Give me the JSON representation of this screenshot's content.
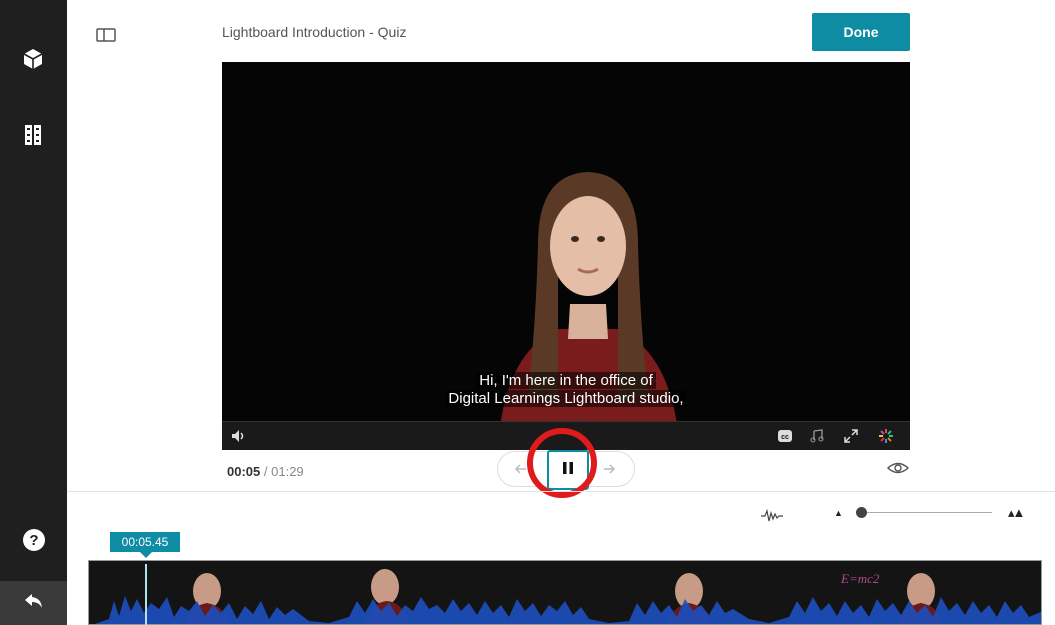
{
  "header": {
    "title": "Lightboard Introduction - Quiz",
    "done_label": "Done"
  },
  "video": {
    "caption_line1": "Hi, I'm here in the office of",
    "caption_line2": "Digital Learnings Lightboard studio,"
  },
  "player": {
    "current_time": "00:05",
    "separator": "/",
    "total_time": "01:29"
  },
  "timeline": {
    "marker_time": "00:05.45",
    "formula_text": "E=mc2"
  },
  "icons": {
    "sidebar": [
      "cube-icon",
      "film-icon",
      "help-icon",
      "back-icon"
    ],
    "video_bar": [
      "volume-icon",
      "closed-captions-icon",
      "music-icon",
      "fullscreen-icon",
      "brand-icon"
    ]
  },
  "colors": {
    "accent": "#0e8ca3",
    "highlight": "#e01b1b",
    "sidebar": "#1f1f1f"
  }
}
